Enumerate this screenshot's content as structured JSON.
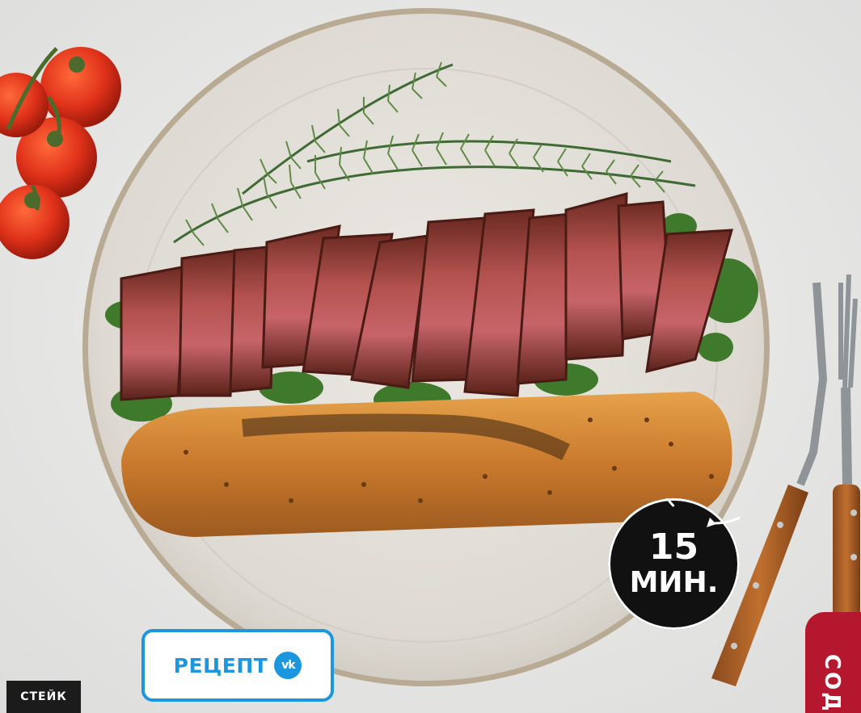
{
  "section_tag": {
    "label": "СТЕЙК"
  },
  "recipe_button": {
    "label": "РЕЦЕПТ",
    "icon": "vk-logo-icon",
    "accent": "#1c97df"
  },
  "time_badge": {
    "value": "15",
    "unit": "МИН."
  },
  "contents_tab": {
    "label": "СОД",
    "color": "#b4172e"
  },
  "photo": {
    "icon": "steak-baguette-photo"
  }
}
